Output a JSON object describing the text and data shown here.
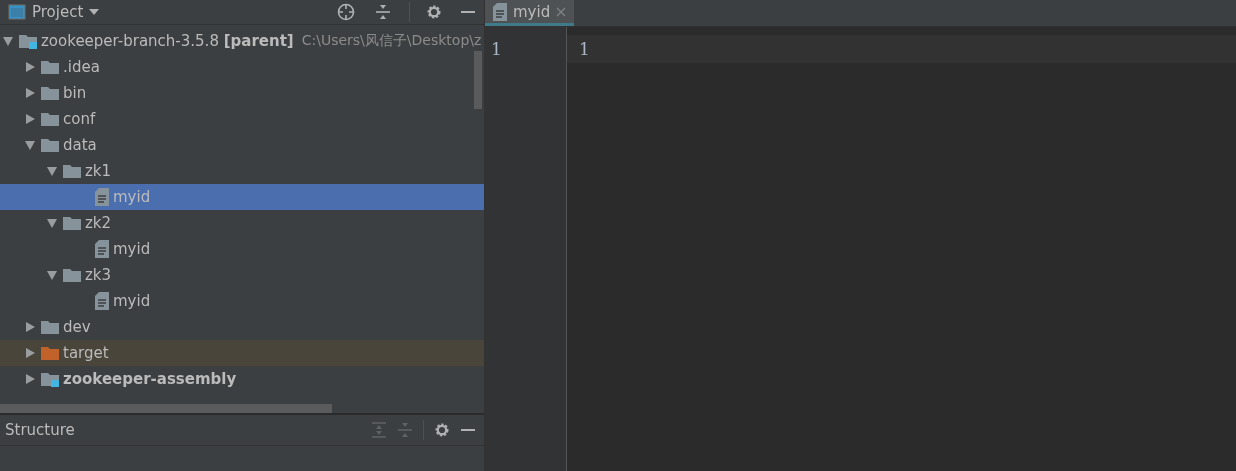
{
  "project_panel": {
    "title": "Project",
    "tree": [
      {
        "label": "zookeeper-branch-3.5.8 **[parent]**",
        "path": "C:\\Users\\风信子\\Desktop\\z",
        "kind": "module",
        "bold": false,
        "expanded": true,
        "selected": false,
        "children": [
          {
            "label": ".idea",
            "kind": "folder",
            "expanded": false,
            "selected": false
          },
          {
            "label": "bin",
            "kind": "folder",
            "expanded": false,
            "selected": false
          },
          {
            "label": "conf",
            "kind": "folder",
            "expanded": false,
            "selected": false
          },
          {
            "label": "data",
            "kind": "folder",
            "expanded": true,
            "selected": false,
            "children": [
              {
                "label": "zk1",
                "kind": "folder",
                "expanded": true,
                "selected": false,
                "children": [
                  {
                    "label": "myid",
                    "kind": "file",
                    "selected": true
                  }
                ]
              },
              {
                "label": "zk2",
                "kind": "folder",
                "expanded": true,
                "selected": false,
                "children": [
                  {
                    "label": "myid",
                    "kind": "file",
                    "selected": false
                  }
                ]
              },
              {
                "label": "zk3",
                "kind": "folder",
                "expanded": true,
                "selected": false,
                "children": [
                  {
                    "label": "myid",
                    "kind": "file",
                    "selected": false
                  }
                ]
              }
            ]
          },
          {
            "label": "dev",
            "kind": "folder",
            "expanded": false,
            "selected": false
          },
          {
            "label": "target",
            "kind": "excluded",
            "expanded": false,
            "selected": false
          },
          {
            "label": "zookeeper-assembly",
            "kind": "module",
            "bold": true,
            "expanded": false,
            "selected": false
          }
        ]
      }
    ]
  },
  "structure_panel": {
    "title": "Structure"
  },
  "editor": {
    "tabs": [
      {
        "label": "myid",
        "selected": true
      }
    ],
    "lines": [
      {
        "number": "1",
        "text": "1"
      }
    ]
  }
}
